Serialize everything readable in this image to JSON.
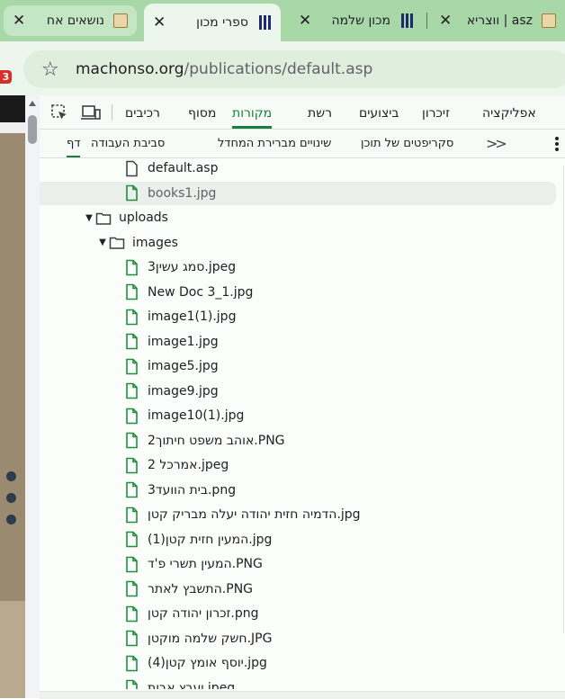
{
  "browser": {
    "tabs": [
      {
        "title": "נושאים אח",
        "favicon": "book-favicon",
        "state": "inactive"
      },
      {
        "title": "ספרי מכון",
        "favicon": "bars-favicon",
        "state": "active"
      },
      {
        "title": "מכון שלמה",
        "favicon": "bars-favicon",
        "state": "inactive"
      },
      {
        "title": "asz | ווצריא",
        "favicon": "book-favicon",
        "state": "inactive"
      }
    ],
    "close_glyph": "✕",
    "notification_badge": "3",
    "url": {
      "domain": "machonso.org",
      "path": "/publications/default.asp"
    }
  },
  "devtools": {
    "main_tabs": [
      "אפליקציה",
      "זיכרון",
      "ביצועים",
      "רשת",
      "מקורות",
      "מסוף",
      "רכיבים"
    ],
    "active_main_tab": "מקורות",
    "sub_tabs": [
      "דף",
      "סביבת העבודה",
      "שינויים מברירת המחדל",
      "סקריפטים של תוכן"
    ],
    "active_sub_tab": "דף",
    "more_tabs_glyph": ">>"
  },
  "file_tree": [
    {
      "name": "default.asp",
      "kind": "doc",
      "depth": 2
    },
    {
      "name": "books1.jpg",
      "kind": "file",
      "depth": 2,
      "selected": true
    },
    {
      "name": "uploads",
      "kind": "folder",
      "depth": 0,
      "expanded": true
    },
    {
      "name": "images",
      "kind": "folder",
      "depth": 1,
      "expanded": true
    },
    {
      "name": "סמג עשין3.jpeg",
      "kind": "file",
      "depth": 2
    },
    {
      "name": "New Doc 3_1.jpg",
      "kind": "file",
      "depth": 2
    },
    {
      "name": "image1(1).jpg",
      "kind": "file",
      "depth": 2
    },
    {
      "name": "image1.jpg",
      "kind": "file",
      "depth": 2
    },
    {
      "name": "image5.jpg",
      "kind": "file",
      "depth": 2
    },
    {
      "name": "image9.jpg",
      "kind": "file",
      "depth": 2
    },
    {
      "name": "image10(1).jpg",
      "kind": "file",
      "depth": 2
    },
    {
      "name": "אוהב משפט חיתוך2.PNG",
      "kind": "file",
      "depth": 2
    },
    {
      "name": "אמרכל 2.jpeg",
      "kind": "file",
      "depth": 2
    },
    {
      "name": "בית הוועד3.png",
      "kind": "file",
      "depth": 2
    },
    {
      "name": "הדמיה חזית יהודה יעלה מבריק קטן.jpg",
      "kind": "file",
      "depth": 2
    },
    {
      "name": "המעין חזית קטן(1).jpg",
      "kind": "file",
      "depth": 2
    },
    {
      "name": "המעין תשרי פ'ד.PNG",
      "kind": "file",
      "depth": 2
    },
    {
      "name": "התשבץ לאתר.PNG",
      "kind": "file",
      "depth": 2
    },
    {
      "name": "זכרון יהודה קטן.png",
      "kind": "file",
      "depth": 2
    },
    {
      "name": "חשק שלמה מוקטן.JPG",
      "kind": "file",
      "depth": 2
    },
    {
      "name": "יוסף אומץ קטן(4).jpg",
      "kind": "file",
      "depth": 2
    },
    {
      "name": "יעבץ אבות.jpeg",
      "kind": "file",
      "depth": 2
    }
  ],
  "colors": {
    "accent_green": "#188038",
    "file_icon_green": "#1e8e3e",
    "tab_strip": "#a8d8a8",
    "toolbar_bg": "#edf6ed"
  }
}
